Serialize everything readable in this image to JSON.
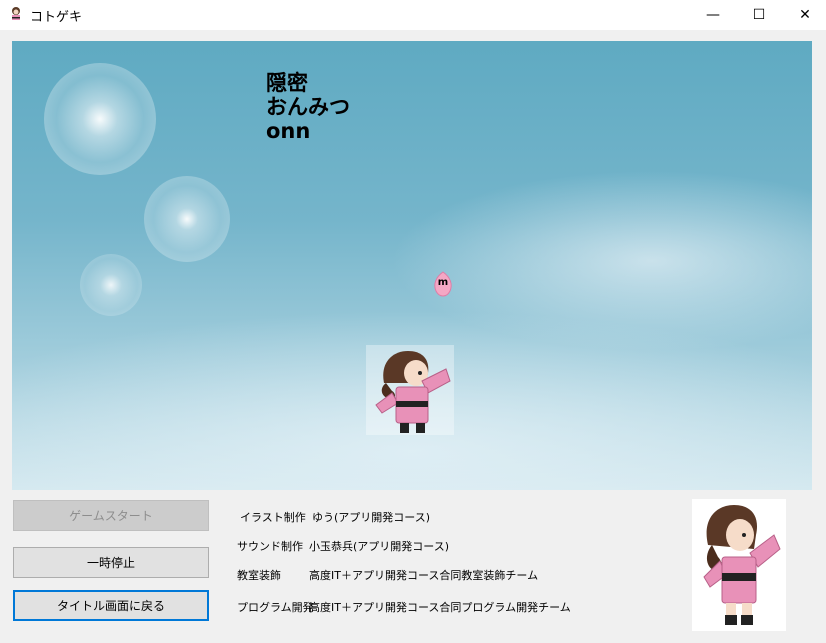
{
  "window": {
    "title": "コトゲキ",
    "icon": "ninja-girl-icon",
    "controls": {
      "minimize": "—",
      "maximize": "☐",
      "close": "✕"
    }
  },
  "game": {
    "word_kanji": "隠密",
    "word_kana": "おんみつ",
    "word_romaji": "onn",
    "enemy_letter": "m"
  },
  "buttons": {
    "start": "ゲームスタート",
    "pause": "一時停止",
    "back_to_title": "タイトル画面に戻る"
  },
  "credits": [
    {
      "label": "イラスト制作",
      "value": "ゆう(アプリ開発コース)"
    },
    {
      "label": "サウンド制作",
      "value": "小玉恭兵(アプリ開発コース)"
    },
    {
      "label": "教室装飾",
      "value": "高度IT＋アプリ開発コース合同教室装飾チーム"
    },
    {
      "label": "プログラム開発",
      "value": "高度IT＋アプリ開発コース合同プログラム開発チーム"
    }
  ],
  "colors": {
    "accent": "#0078d7",
    "sky": "#75b5cb",
    "kimono": "#e891b8"
  }
}
